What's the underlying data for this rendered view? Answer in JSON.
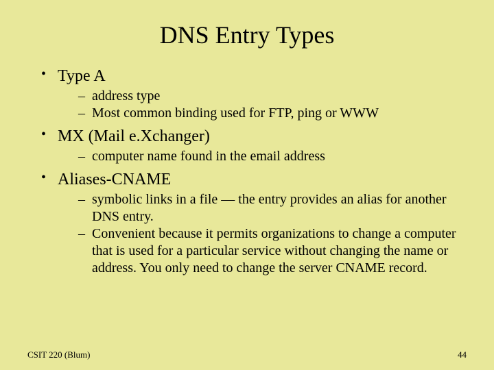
{
  "title": "DNS Entry Types",
  "bullets": [
    {
      "label": "Type A",
      "sub": [
        "address type",
        "Most common binding used for FTP, ping or WWW"
      ]
    },
    {
      "label": "MX (Mail e.Xchanger)",
      "sub": [
        "computer name found in the email address"
      ]
    },
    {
      "label": "Aliases-CNAME",
      "sub": [
        "symbolic links in a file — the entry provides an alias for another DNS entry.",
        "Convenient because it permits organizations to change a computer that is used for a particular service without changing the name or address. You only need to change the server CNAME record."
      ]
    }
  ],
  "footer": {
    "left": "CSIT 220 (Blum)",
    "right": "44"
  }
}
